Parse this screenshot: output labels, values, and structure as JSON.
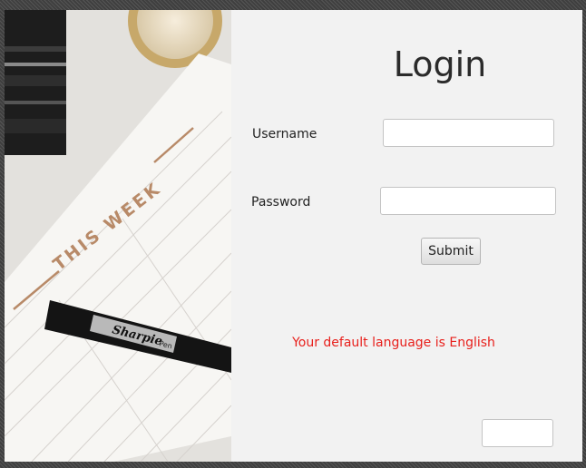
{
  "login": {
    "title": "Login",
    "username_label": "Username",
    "username_value": "",
    "password_label": "Password",
    "password_value": "",
    "submit_label": "Submit",
    "language_message": "Your default language is English",
    "language_field_value": ""
  },
  "photo": {
    "planner_heading": "THIS WEEK",
    "pen_brand": "Sharpie",
    "pen_subtext": "Pen"
  },
  "colors": {
    "background": "#f2f2f2",
    "message_red": "#e8201c",
    "planner_accent": "#b88a68"
  }
}
